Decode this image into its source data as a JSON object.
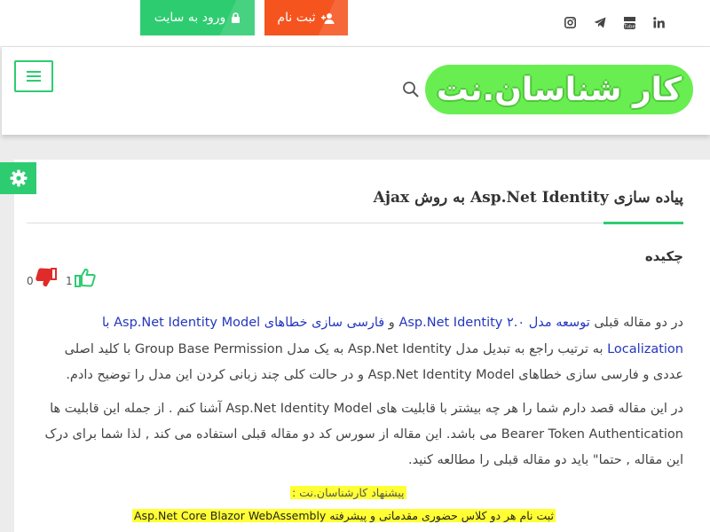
{
  "topbar": {
    "login_label": "ورود به سایت",
    "register_label": "ثبت نام",
    "social_icons": [
      "instagram-icon",
      "telegram-icon",
      "youtube-icon",
      "linkedin-icon"
    ]
  },
  "header": {
    "logo_text": "کار شناسان.نت"
  },
  "article": {
    "title": "پیاده سازی Asp.Net Identity به روش Ajax",
    "abstract_heading": "چکیده",
    "likes": "1",
    "dislikes": "0",
    "p1": {
      "l1_a": "در دو مقاله قبلی ",
      "l1_link1": "توسعه مدل Asp.Net Identity ۲.۰",
      "l1_b": " و ",
      "l1_link2": "فارسی سازی خطاهای Asp.Net Identity Model با",
      "l2_link": "Localization",
      "l2_text": " به ترتیب راجع به تبدیل مدل Asp.Net Identity به یک مدل Group Base Permission با کلید اصلی",
      "l3_text": "عددی و فارسی سازی خطاهای Asp.Net Identity Model و در حالت کلی چند زبانی کردن این مدل را توضیح دادم."
    },
    "p2": {
      "l1": "در این مقاله قصد دارم شما را هر چه بیشتر با قابلیت های Asp.Net Identity Model آشنا کنم . از جمله این قابلیت ها",
      "l2": "Bearer Token Authentication می باشد. این مقاله از سورس کد دو مقاله قبلی استفاده می کند , لذا شما برای درک",
      "l3": "این مقاله , حتما\" باید دو مقاله قبلی را مطالعه کنید."
    },
    "suggestion": "پیشنهاد کارشناسان.نت :",
    "promo": "ثبت نام هر دو کلاس حضوری مقدماتی و پیشرفته Asp.Net Core Blazor WebAssembly"
  },
  "colors": {
    "accent_green": "#2ecc71",
    "register_orange": "#f5541f",
    "logo_green": "#69ee52",
    "link_blue": "#2336c0",
    "highlight_yellow": "#ffff33"
  }
}
